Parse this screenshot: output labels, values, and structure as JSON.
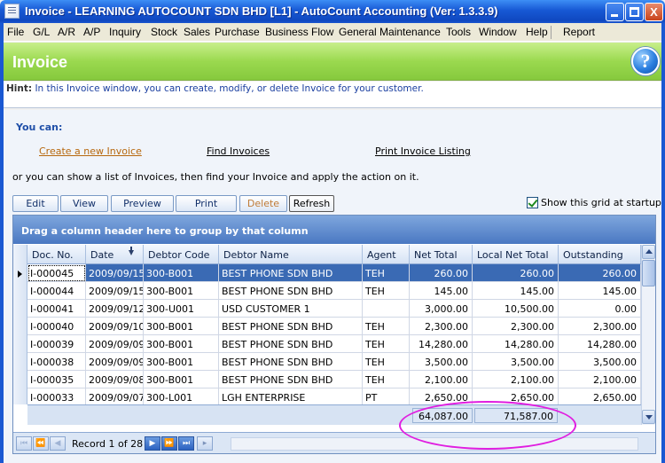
{
  "window": {
    "title": "Invoice - LEARNING AUTOCOUNT SDN BHD [L1] - AutoCount Accounting (Ver: 1.3.3.9)",
    "min_label": "_",
    "max_label": "□",
    "close_label": "X"
  },
  "menu": [
    "File",
    "G/L",
    "A/R",
    "A/P",
    "Inquiry",
    "Stock",
    "Sales",
    "Purchase",
    "Business Flow",
    "General Maintenance",
    "Tools",
    "Window",
    "Help",
    "Report"
  ],
  "header": {
    "title": "Invoice",
    "help_label": "?"
  },
  "hint": {
    "label": "Hint:",
    "text": "In this Invoice window, you can create, modify, or delete Invoice for your customer."
  },
  "actions": {
    "you_can": "You can:",
    "create": "Create a new Invoice",
    "find": "Find Invoices",
    "print_listing": "Print Invoice Listing",
    "or_text": "or you can show a list of Invoices, then find your Invoice and apply the action on it."
  },
  "toolbar": {
    "edit": "Edit",
    "view": "View",
    "preview": "Preview",
    "print": "Print",
    "delete": "Delete",
    "refresh": "Refresh",
    "show_grid": "Show this grid at startup"
  },
  "grid": {
    "group_panel": "Drag a column header here to group by that column",
    "columns": [
      "Doc. No.",
      "Date",
      "Debtor Code",
      "Debtor Name",
      "Agent",
      "Net Total",
      "Local Net Total",
      "Outstanding"
    ],
    "rows": [
      [
        "I-000045",
        "2009/09/15",
        "300-B001",
        "BEST PHONE SDN BHD",
        "TEH",
        "260.00",
        "260.00",
        "260.00"
      ],
      [
        "I-000044",
        "2009/09/15",
        "300-B001",
        "BEST PHONE SDN BHD",
        "TEH",
        "145.00",
        "145.00",
        "145.00"
      ],
      [
        "I-000041",
        "2009/09/12",
        "300-U001",
        "USD CUSTOMER 1",
        "",
        "3,000.00",
        "10,500.00",
        "0.00"
      ],
      [
        "I-000040",
        "2009/09/10",
        "300-B001",
        "BEST PHONE SDN BHD",
        "TEH",
        "2,300.00",
        "2,300.00",
        "2,300.00"
      ],
      [
        "I-000039",
        "2009/09/09",
        "300-B001",
        "BEST PHONE SDN BHD",
        "TEH",
        "14,280.00",
        "14,280.00",
        "14,280.00"
      ],
      [
        "I-000038",
        "2009/09/09",
        "300-B001",
        "BEST PHONE SDN BHD",
        "TEH",
        "3,500.00",
        "3,500.00",
        "3,500.00"
      ],
      [
        "I-000035",
        "2009/09/08",
        "300-B001",
        "BEST PHONE SDN BHD",
        "TEH",
        "2,100.00",
        "2,100.00",
        "2,100.00"
      ],
      [
        "I-000033",
        "2009/09/07",
        "300-L001",
        "LGH ENTERPRISE",
        "PT",
        "2,650.00",
        "2,650.00",
        "2,650.00"
      ]
    ],
    "footer": {
      "net_total": "64,087.00",
      "local_net_total": "71,587.00"
    },
    "record_text": "Record 1 of 28"
  },
  "colors": {
    "title_bar": "#1758d4",
    "header_green": "#9bd94f",
    "selection": "#3a6ab4",
    "annotation": "#e01ee0"
  }
}
